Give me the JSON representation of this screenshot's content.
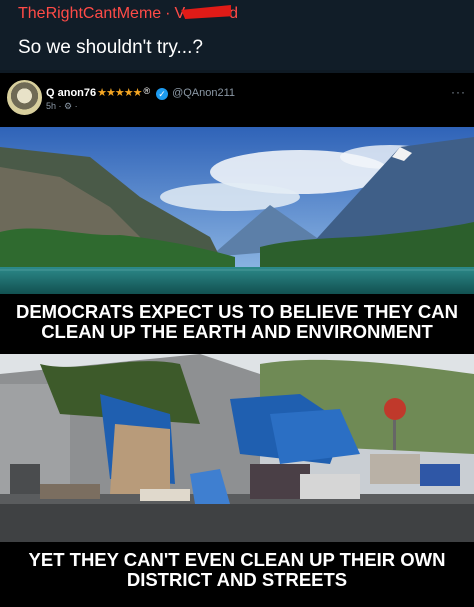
{
  "post": {
    "subreddit": "TheRightCantMeme",
    "separator": "·",
    "author_prefix": "V",
    "author_suffix": "d",
    "title": "So we shouldn't try...?"
  },
  "tweet": {
    "display_name": "Q anon76",
    "stars": "★★★★★",
    "registered_mark": "®",
    "verified_icon": "verified-badge-icon",
    "handle": "@QAnon211",
    "time": "5h",
    "dot": "·",
    "more": "···",
    "caption_top": "DEMOCRATS EXPECT US TO BELIEVE THEY CAN CLEAN UP THE EARTH AND ENVIRONMENT",
    "caption_bottom": "YET THEY CAN'T EVEN CLEAN UP THEIR OWN DISTRICT AND STREETS"
  },
  "colors": {
    "background": "#0f1a24",
    "subreddit_red": "#ff4b47",
    "verified_blue": "#1d9bf0",
    "star_gold": "#f5a623"
  }
}
